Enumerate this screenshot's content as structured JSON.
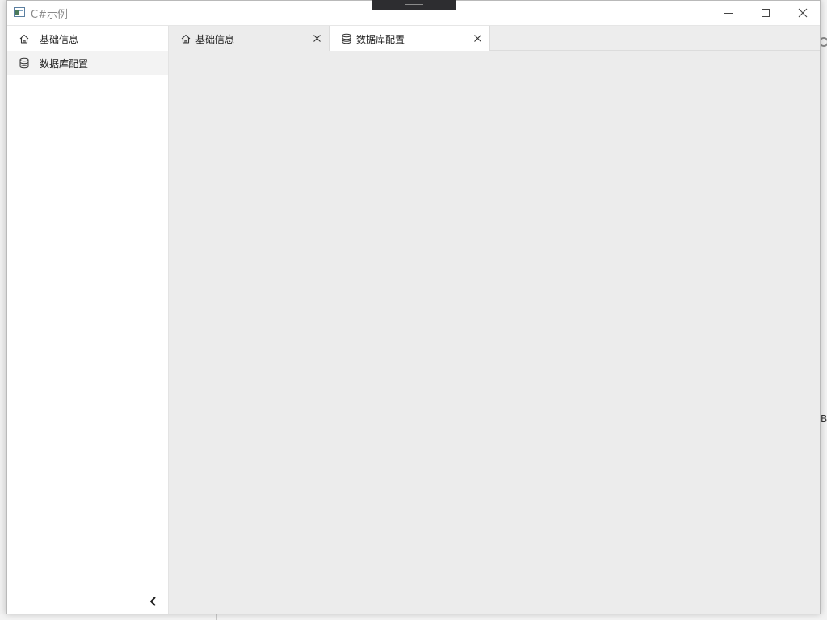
{
  "window": {
    "title": "C#示例"
  },
  "sidebar": {
    "items": [
      {
        "label": "基础信息",
        "icon": "home-icon",
        "active": false
      },
      {
        "label": "数据库配置",
        "icon": "database-icon",
        "active": true
      }
    ],
    "collapse_icon": "chevron-left-icon"
  },
  "tabs": [
    {
      "label": "基础信息",
      "icon": "home-icon",
      "active": false
    },
    {
      "label": "数据库配置",
      "icon": "database-icon",
      "active": true
    }
  ],
  "colors": {
    "content_bg": "#ececec",
    "active_item_bg": "#f3f3f3",
    "text": "#1e1e1e",
    "title_text": "#8a8a8a"
  },
  "background": {
    "fragment_text": "B"
  }
}
